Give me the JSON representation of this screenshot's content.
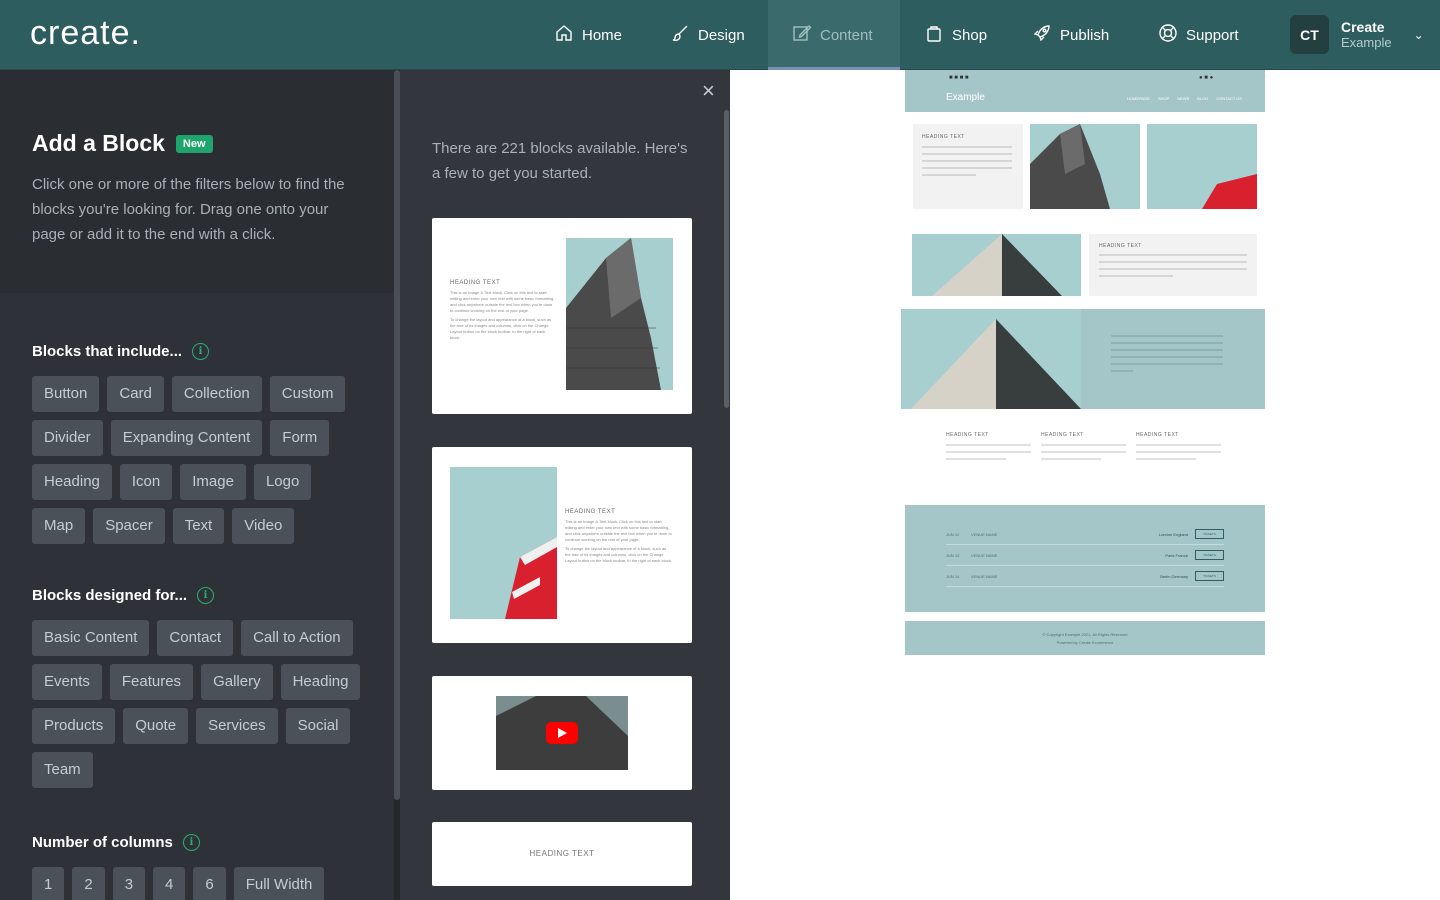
{
  "app": {
    "logo": "create."
  },
  "nav": {
    "items": [
      {
        "label": "Home",
        "icon": "home-icon"
      },
      {
        "label": "Design",
        "icon": "brush-icon"
      },
      {
        "label": "Content",
        "icon": "edit-icon",
        "active": true
      },
      {
        "label": "Shop",
        "icon": "bag-icon"
      },
      {
        "label": "Publish",
        "icon": "rocket-icon"
      },
      {
        "label": "Support",
        "icon": "lifebuoy-icon"
      }
    ],
    "account": {
      "initials": "CT",
      "name": "Create",
      "site": "Example"
    }
  },
  "panel": {
    "title": "Add a Block",
    "badge": "New",
    "description": "Click one or more of the filters below to find the blocks you're looking for. Drag one onto your page or add it to the end with a click.",
    "include_heading": "Blocks that include...",
    "include_chips": [
      "Button",
      "Card",
      "Collection",
      "Custom",
      "Divider",
      "Expanding Content",
      "Form",
      "Heading",
      "Icon",
      "Image",
      "Logo",
      "Map",
      "Spacer",
      "Text",
      "Video"
    ],
    "designed_heading": "Blocks designed for...",
    "designed_chips": [
      "Basic Content",
      "Contact",
      "Call to Action",
      "Events",
      "Features",
      "Gallery",
      "Heading",
      "Products",
      "Quote",
      "Services",
      "Social",
      "Team"
    ],
    "columns_heading": "Number of columns",
    "columns_chips": [
      "1",
      "2",
      "3",
      "4",
      "6",
      "Full Width"
    ]
  },
  "blocks": {
    "close": "×",
    "intro": "There are 221 blocks available. Here's a few to get you started.",
    "card1": {
      "heading": "HEADING TEXT",
      "p1": "This is an Image & Text block. Click on this text to start editing and enter your own text with some basic formatting, and click anywhere outside the text box when you're done to continue working on the rest of your page.",
      "p2": "To change the layout and appearance of a block, such as the size of its images and columns, click on the Change Layout button on the block toolbar, to the right of each block."
    },
    "card2": {
      "heading": "HEADING TEXT",
      "p1": "This is an Image & Text block. Click on this text to start editing and enter your own text with some basic formatting, and click anywhere outside the text box when you're done to continue working on the rest of your page.",
      "p2": "To change the layout and appearance of a block, such as the size of its images and columns, click on the Change Layout button on the block toolbar, to the right of each block."
    },
    "card4": {
      "heading": "HEADING TEXT"
    }
  },
  "preview": {
    "site_logo": "Example",
    "menu": [
      "HOMEPAGE",
      "SHOP",
      "NEWS",
      "BLOG",
      "CONTACT US"
    ],
    "heading": "HEADING TEXT",
    "col_headings": [
      "HEADING TEXT",
      "HEADING TEXT",
      "HEADING TEXT"
    ],
    "events": [
      {
        "date": "JUN 12",
        "venue": "VENUE NAME",
        "city": "London England",
        "btn": "TICKETS"
      },
      {
        "date": "JUN 13",
        "venue": "VENUE NAME",
        "city": "Paris France",
        "btn": "TICKETS"
      },
      {
        "date": "JUN 14",
        "venue": "VENUE NAME",
        "city": "Berlin Germany",
        "btn": "TICKETS"
      }
    ],
    "footer1": "© Copyright Example 2021. All Rights Reserved",
    "footer2": "Powered by Create Ecommerce"
  },
  "colors": {
    "topbar": "#2d5d5e",
    "accent_green": "#1ea56b",
    "preview_teal": "#a5c6c8"
  }
}
